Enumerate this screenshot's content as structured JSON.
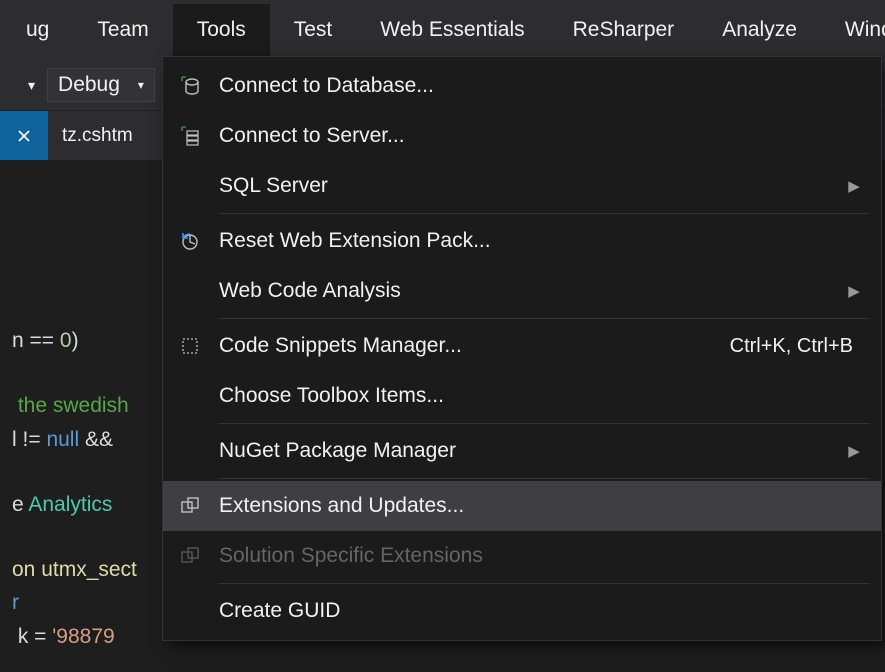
{
  "menubar": {
    "items": [
      "ug",
      "Team",
      "Tools",
      "Test",
      "Web Essentials",
      "ReSharper",
      "Analyze",
      "Windo"
    ],
    "active_index": 2
  },
  "toolbar": {
    "config_label": "Debug"
  },
  "tabs": {
    "active_label": "tz.cshtm"
  },
  "editor": {
    "line1_a": "n ",
    "line1_b": "==",
    "line1_c": " ",
    "line1_d": "0",
    "line1_e": ")",
    "line2_a": " the swedish",
    "line3_a": "l ",
    "line3_b": "!=",
    "line3_c": " ",
    "line3_d": "null",
    "line3_e": " ",
    "line3_f": "&&",
    "line4_a": "e ",
    "line4_b": "Analytics",
    "line5_a": "on utmx_sect",
    "line6_a": "r",
    "line7_a": " k ",
    "line7_b": "=",
    "line7_c": " ",
    "line7_d": "'98879"
  },
  "menu": {
    "items": [
      {
        "label": "Connect to Database...",
        "icon": "db-icon",
        "has_sub": false,
        "shortcut": "",
        "disabled": false
      },
      {
        "label": "Connect to Server...",
        "icon": "server-icon",
        "has_sub": false,
        "shortcut": "",
        "disabled": false
      },
      {
        "label": "SQL Server",
        "icon": "",
        "has_sub": true,
        "shortcut": "",
        "disabled": false
      },
      {
        "sep": true
      },
      {
        "label": "Reset Web Extension Pack...",
        "icon": "reset-icon",
        "has_sub": false,
        "shortcut": "",
        "disabled": false
      },
      {
        "label": "Web Code Analysis",
        "icon": "",
        "has_sub": true,
        "shortcut": "",
        "disabled": false
      },
      {
        "sep": true
      },
      {
        "label": "Code Snippets Manager...",
        "icon": "snippets-icon",
        "has_sub": false,
        "shortcut": "Ctrl+K, Ctrl+B",
        "disabled": false
      },
      {
        "label": "Choose Toolbox Items...",
        "icon": "",
        "has_sub": false,
        "shortcut": "",
        "disabled": false
      },
      {
        "sep": true
      },
      {
        "label": "NuGet Package Manager",
        "icon": "",
        "has_sub": true,
        "shortcut": "",
        "disabled": false
      },
      {
        "sep": true
      },
      {
        "label": "Extensions and Updates...",
        "icon": "extensions-icon",
        "has_sub": false,
        "shortcut": "",
        "disabled": false,
        "highlight": true
      },
      {
        "label": "Solution Specific Extensions",
        "icon": "sln-ext-icon",
        "has_sub": false,
        "shortcut": "",
        "disabled": true
      },
      {
        "sep": true
      },
      {
        "label": "Create GUID",
        "icon": "",
        "has_sub": false,
        "shortcut": "",
        "disabled": false
      }
    ]
  }
}
